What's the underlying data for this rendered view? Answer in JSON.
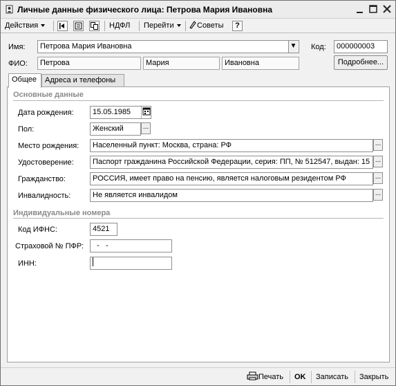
{
  "window": {
    "title": "Личные данные физического лица: Петрова  Мария Ивановна"
  },
  "toolbar": {
    "actions_label": "Действия",
    "ndfl_label": "НДФЛ",
    "goto_label": "Перейти",
    "tips_label": "Советы",
    "help_label": "?"
  },
  "header": {
    "name_label": "Имя:",
    "name_value": "Петрова  Мария Ивановна",
    "code_label": "Код:",
    "code_value": "000000003",
    "fio_label": "ФИО:",
    "surname": "Петрова",
    "firstname": "Мария",
    "patronymic": "Ивановна",
    "details_button": "Подробнее..."
  },
  "tabs": [
    {
      "label": "Общее",
      "active": true
    },
    {
      "label": "Адреса и телефоны",
      "active": false
    }
  ],
  "basic": {
    "section_title": "Основные данные",
    "birthdate_label": "Дата рождения:",
    "birthdate_value": "15.05.1985",
    "gender_label": "Пол:",
    "gender_value": "Женский",
    "birthplace_label": "Место рождения:",
    "birthplace_value": "Населенный пункт: Москва, страна: РФ",
    "id_label": "Удостоверение:",
    "id_value": "Паспорт гражданина Российской Федерации, серия: ПП, № 512547, выдан: 15",
    "citizenship_label": "Гражданство:",
    "citizenship_value": "РОССИЯ, имеет право на пенсию, является налоговым резидентом РФ",
    "disability_label": "Инвалидность:",
    "disability_value": "Не является инвалидом"
  },
  "numbers": {
    "section_title": "Индивидуальные номера",
    "ifns_label": "Код ИФНС:",
    "ifns_value": "4521",
    "pfr_label": "Страховой № ПФР:",
    "pfr_value": "  -   -",
    "inn_label": "ИНН:",
    "inn_value": ""
  },
  "footer": {
    "print_label": "Печать",
    "ok_label": "OK",
    "save_label": "Записать",
    "close_label": "Закрыть"
  },
  "icons": {
    "app": "person-card-icon",
    "minimize": "minimize-icon",
    "maximize": "maximize-icon",
    "close": "close-icon",
    "tb1": "goto-list-icon",
    "tb2": "refresh-icon",
    "tb3": "copy-icon",
    "tips": "tips-icon",
    "calendar": "calendar-icon",
    "print": "printer-icon"
  }
}
